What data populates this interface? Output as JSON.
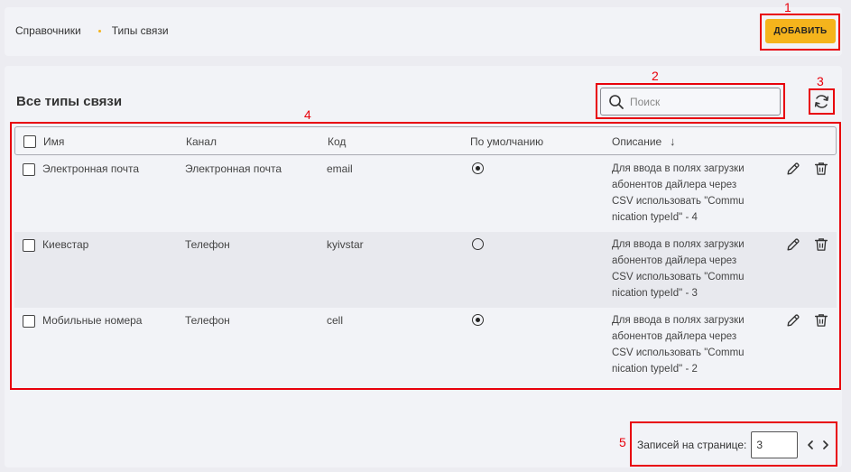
{
  "breadcrumb": {
    "root": "Справочники",
    "current": "Типы связи"
  },
  "toolbar": {
    "add_label": "ДОБАВИТЬ"
  },
  "panel": {
    "title": "Все типы связи"
  },
  "search": {
    "placeholder": "Поиск"
  },
  "table": {
    "columns": {
      "name": "Имя",
      "channel": "Канал",
      "code": "Код",
      "default": "По умолчанию",
      "description": "Описание"
    },
    "sort_indicator": "↓",
    "rows": [
      {
        "name": "Электронная почта",
        "channel": "Электронная почта",
        "code": "email",
        "default": true,
        "desc_lines": [
          "Для ввода в полях загрузки",
          "абонентов дайлера через",
          "CSV использовать \"Commu",
          "nication typeId\" - 4"
        ]
      },
      {
        "name": "Киевстар",
        "channel": "Телефон",
        "code": "kyivstar",
        "default": false,
        "desc_lines": [
          "Для ввода в полях загрузки",
          "абонентов дайлера через",
          "CSV использовать \"Commu",
          "nication typeId\" - 3"
        ]
      },
      {
        "name": "Мобильные номера",
        "channel": "Телефон",
        "code": "cell",
        "default": true,
        "desc_lines": [
          "Для ввода в полях загрузки",
          "абонентов дайлера через",
          "CSV использовать \"Commu",
          "nication typeId\" - 2"
        ]
      }
    ]
  },
  "pagination": {
    "label": "Записей на странице:",
    "per_page": "3"
  },
  "annotations": [
    "1",
    "2",
    "3",
    "4",
    "5"
  ],
  "colors": {
    "accent": "#f5b41c",
    "annotation": "#e8000b"
  },
  "icons": [
    "search-icon",
    "refresh-icon",
    "edit-icon",
    "trash-icon",
    "chevron-left-icon",
    "chevron-right-icon",
    "sort-down-icon"
  ]
}
